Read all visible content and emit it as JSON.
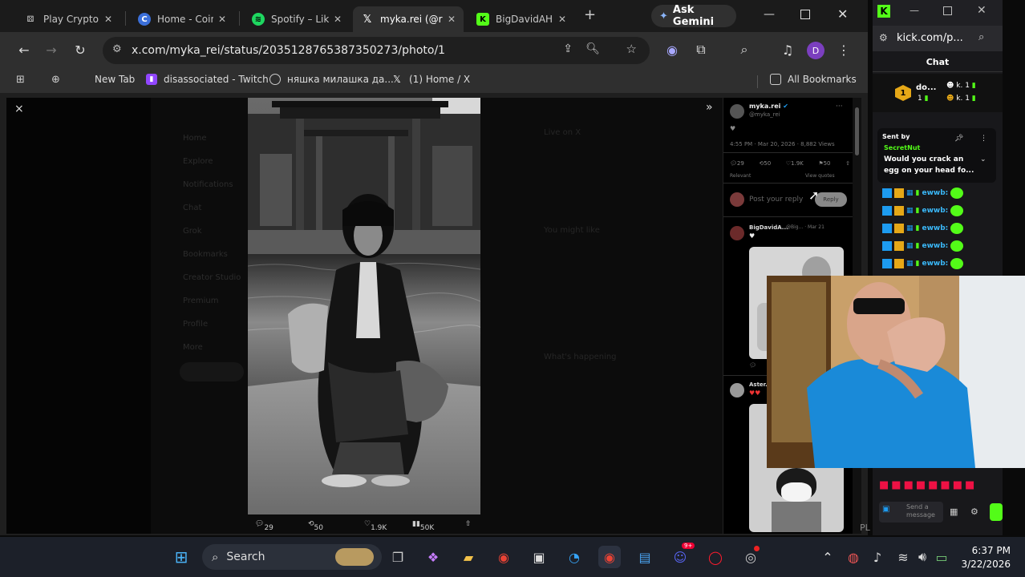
{
  "browser": {
    "tabs": [
      {
        "title": "Play Crypto C",
        "favicon": "dice-icon"
      },
      {
        "title": "Home - Coin",
        "favicon": "coin-icon"
      },
      {
        "title": "Spotify – Lik",
        "favicon": "spotify-icon"
      },
      {
        "title": "myka.rei (@r",
        "favicon": "x-icon"
      },
      {
        "title": "BigDavidAH",
        "favicon": "kick-icon"
      }
    ],
    "new_tab": "+",
    "gemini_label": "Ask Gemini",
    "url": "x.com/myka_rei/status/2035128765387350273/photo/1",
    "profile_initial": "D",
    "bookmarks": [
      "New Tab",
      "disassociated - Twitch",
      "няшка милашка да...",
      "(1) Home / X"
    ],
    "all_bookmarks": "All Bookmarks"
  },
  "x_page": {
    "close": "×",
    "expand": "»",
    "photo_actions": [
      "29",
      "50",
      "1.9K",
      "50K"
    ],
    "post": {
      "name": "myka.rei",
      "handle": "@myka_rei",
      "time": "4:55 PM · Mar 20, 2026 · 8,882 Views",
      "stats": [
        "29",
        "50",
        "1.9K",
        "50"
      ],
      "relevant": "Relevant",
      "view_quotes": "View quotes",
      "reply_placeholder": "Post your reply",
      "reply_button": "Reply"
    },
    "replies": [
      {
        "name": "BigDavidA...",
        "meta": "@Big... · Mar 21",
        "text": "♥"
      },
      {
        "name": "Aster...",
        "meta": "",
        "text": "♥♥"
      }
    ],
    "left_nav": [
      "Home",
      "Explore",
      "Notifications",
      "Chat",
      "Grok",
      "Bookmarks",
      "Creator Studio",
      "Premium",
      "Profile",
      "More"
    ],
    "right_sidebar": [
      "Live on X",
      "You might like",
      "What's happening"
    ]
  },
  "kick": {
    "url": "kick.com/p...",
    "chat_title": "Chat",
    "top_user": "do...",
    "top_counts": [
      "1",
      "1",
      "1"
    ],
    "pinned_label": "Sent by",
    "pinned_user": "SecretNut",
    "pinned_message": "Would you crack an egg on your head fo...",
    "chat_user": "ewwb:",
    "send_placeholder": "Send a message",
    "bottom_text": "PL"
  },
  "taskbar": {
    "search_label": "Search",
    "time": "6:37 PM",
    "date": "3/22/2026",
    "discord_badge": "9+"
  }
}
